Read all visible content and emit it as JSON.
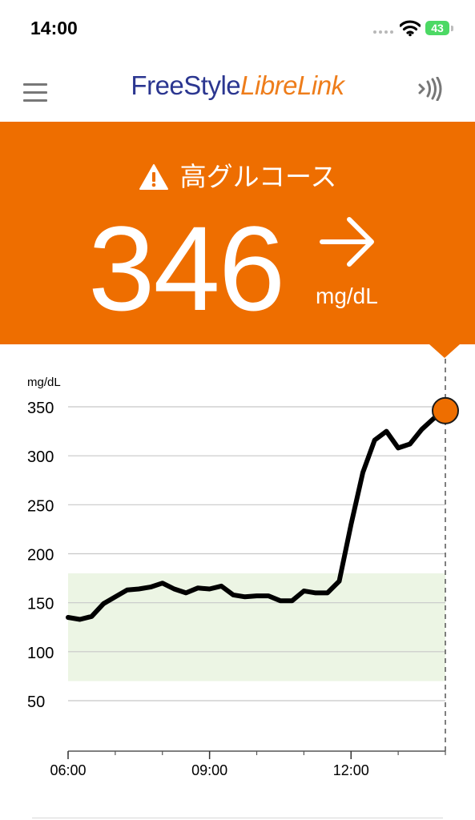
{
  "status_bar": {
    "time": "14:00",
    "battery": "43"
  },
  "header": {
    "brand_part1": "FreeStyle",
    "brand_part2": "LibreLink"
  },
  "alert": {
    "label": "高グルコース",
    "value": "346",
    "unit": "mg/dL",
    "trend": "steady"
  },
  "colors": {
    "banner": "#ee6e00",
    "target_range": "#ecf5e4",
    "line": "#000000",
    "marker": "#ee6e00",
    "brand_blue": "#2b3690",
    "brand_orange": "#ee7d1b"
  },
  "chart_data": {
    "type": "line",
    "ylabel": "mg/dL",
    "y_ticks": [
      350,
      300,
      250,
      200,
      150,
      100,
      50
    ],
    "x_ticks": [
      "06:00",
      "09:00",
      "12:00"
    ],
    "ylim": [
      0,
      350
    ],
    "xlim": [
      "06:00",
      "14:00"
    ],
    "grid": true,
    "target_range": [
      70,
      180
    ],
    "current": {
      "x": "14:00",
      "y": 346
    },
    "series": [
      {
        "x": [
          "06:00",
          "06:15",
          "06:30",
          "06:45",
          "07:00",
          "07:15",
          "07:30",
          "07:45",
          "08:00",
          "08:15",
          "08:30",
          "08:45",
          "09:00",
          "09:15",
          "09:30",
          "09:45",
          "10:00",
          "10:15",
          "10:30",
          "10:45",
          "11:00",
          "11:15",
          "11:30",
          "11:45",
          "12:00",
          "12:15",
          "12:30",
          "12:45",
          "13:00",
          "13:15",
          "13:30",
          "13:45",
          "14:00"
        ],
        "y": [
          135,
          133,
          136,
          149,
          156,
          163,
          164,
          166,
          170,
          164,
          160,
          165,
          164,
          167,
          158,
          156,
          157,
          157,
          152,
          152,
          162,
          160,
          160,
          172,
          230,
          283,
          316,
          325,
          308,
          312,
          327,
          338,
          346
        ]
      }
    ]
  }
}
